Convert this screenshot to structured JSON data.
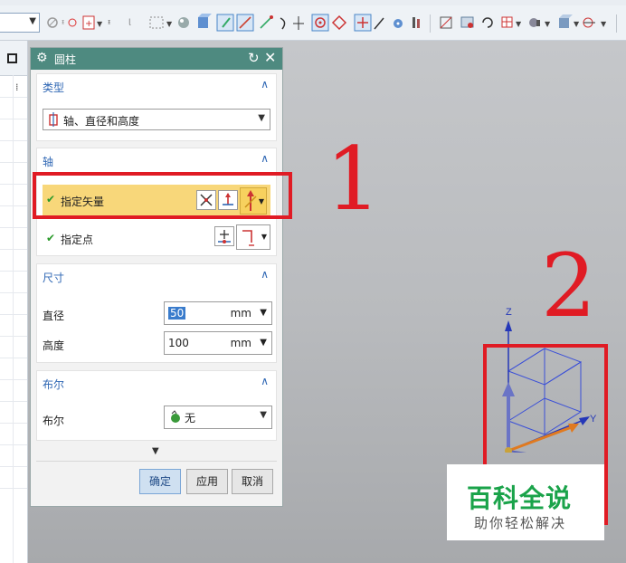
{
  "dialog": {
    "title": "圆柱",
    "icons": {
      "title": "gear-icon",
      "reset": "reset-icon",
      "close": "close-icon"
    },
    "type_section": {
      "title": "类型",
      "selected": "轴、直径和高度"
    },
    "axis_section": {
      "title": "轴",
      "specify_vector_label": "指定矢量",
      "specify_point_label": "指定点"
    },
    "dimensions_section": {
      "title": "尺寸",
      "diameter_label": "直径",
      "diameter_value": "50",
      "diameter_unit": "mm",
      "height_label": "高度",
      "height_value": "100",
      "height_unit": "mm"
    },
    "boolean_section": {
      "title": "布尔",
      "label": "布尔",
      "selected": "无"
    },
    "buttons": {
      "ok": "确定",
      "apply": "应用",
      "cancel": "取消"
    }
  },
  "annotations": {
    "label1": "1",
    "label2": "2",
    "color": "#e01b24"
  },
  "triad": {
    "z_label": "Z",
    "y_label": "Y"
  },
  "watermark": {
    "title": "百科全说",
    "subtitle": "助你轻松解决"
  },
  "colors": {
    "titlebar": "#4e8a80",
    "section_title": "#2f67b4",
    "highlight_row": "#f8d77a",
    "check": "#2a9a2a",
    "watermark_green": "#1aa34a"
  }
}
